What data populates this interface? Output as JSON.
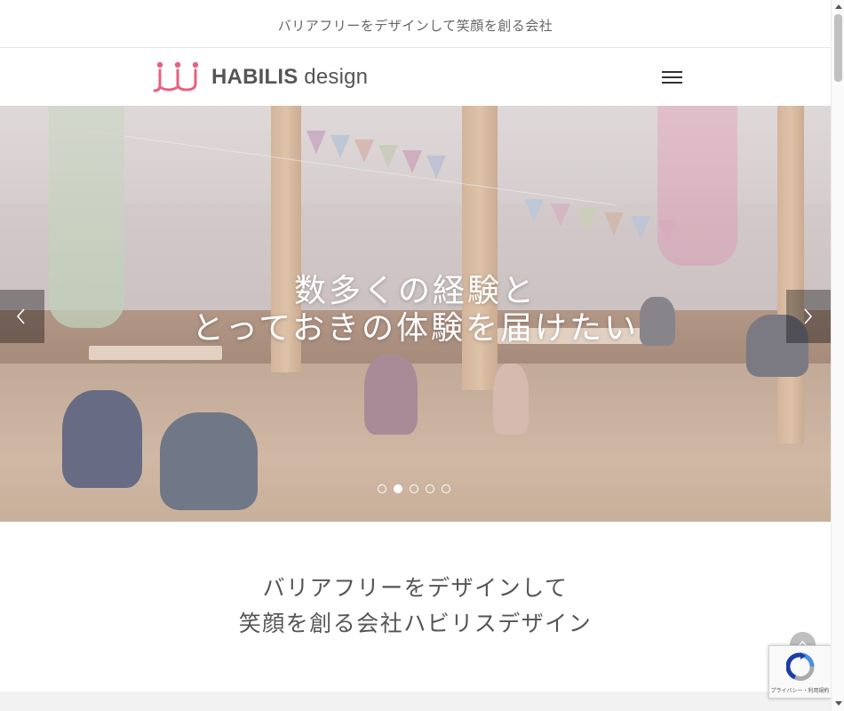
{
  "topbar": {
    "tagline": "バリアフリーをデザインして笑顔を創る会社"
  },
  "header": {
    "logo_text_bold": "HABILIS",
    "logo_text_light": " design",
    "menu_icon": "hamburger-icon"
  },
  "hero": {
    "headline_line1": "数多くの経験と",
    "headline_line2": "とっておきの体験を届けたい",
    "prev_icon": "chevron-left-icon",
    "next_icon": "chevron-right-icon",
    "slide_count": 5,
    "active_slide": 2
  },
  "intro": {
    "line1": "バリアフリーをデザインして",
    "line2": "笑顔を創る会社ハビリスデザイン"
  },
  "widgets": {
    "back_to_top_icon": "chevron-up-icon",
    "recaptcha_legal": "プライバシー・利用規約",
    "recaptcha_icon": "recaptcha-icon"
  },
  "colors": {
    "logo_accent": "#e8607e",
    "text_gray": "#555555"
  }
}
